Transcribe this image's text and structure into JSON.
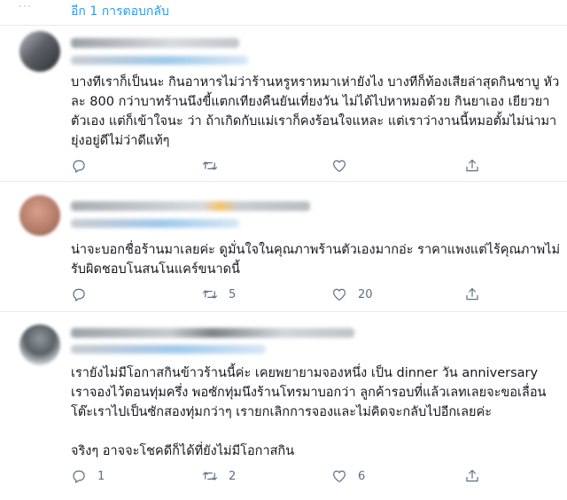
{
  "show_more": {
    "label": "อีก 1 การตอบกลับ"
  },
  "replies": [
    {
      "text": "บางทีเราก็เป็นนะ กินอาหารไม่ว่าร้านหรูหราหมาเห่ายังไง บางทีก็ท้องเสียล่าสุดกินชาบู หัวละ 800 กว่าบาทร้านนึงขี้แตกเทียงคืนยันเที่ยงวัน ไม่ได้ไปหาหมอด้วย กินยาเอง เยียวยาตัวเอง  แต่ก็เข้าใจนะ ว่า ถ้าเกิดกับแม่เราก็คงร้อนใจแหละ แต่เราว่างานนี้หมอตั้มไม่น่ามายุ่งอยู่ดีไม่ว่าดีแท้ๆ",
      "reply_count": "",
      "retweet_count": "",
      "like_count": ""
    },
    {
      "text": "น่าจะบอกชื่อร้านมาเลยค่ะ ดูมั่นใจในคุณภาพร้านตัวเองมากอ่ะ ราคาแพงแต่ไร้คุณภาพไม่รับผิดชอบโนสนโนแคร์ขนาดนี้",
      "reply_count": "",
      "retweet_count": "5",
      "like_count": "20"
    },
    {
      "text": "เรายังไม่มีโอกาสกินข้าวร้านนี้ค่ะ เคยพยายามจองหนึ่ง เป็น dinner วัน anniversary เราจองไว้ตอนทุ่มครึ่ง พอซักทุ่มนึงร้านโทรมาบอกว่า ลูกค้ารอบที่แล้วเลทเลยจะขอเลื่อนโต๊ะเราไปเป็นซักสองทุ่มกว่าๆ เรายกเลิกการจองและไม่คิดจะกลับไปอีกเลยค่ะ\n\nจริงๆ อาจจะโชคดีก็ได้ที่ยังไม่มีโอกาสกิน",
      "reply_count": "1",
      "retweet_count": "2",
      "like_count": "6"
    }
  ],
  "icons": {
    "reply": "reply-icon",
    "retweet": "retweet-icon",
    "like": "heart-icon",
    "share": "share-icon",
    "more": "thread-dots-icon"
  },
  "colors": {
    "link": "#1da1f2",
    "icon": "#5b7083",
    "divider": "#e6ecf0",
    "text": "#14171a"
  }
}
